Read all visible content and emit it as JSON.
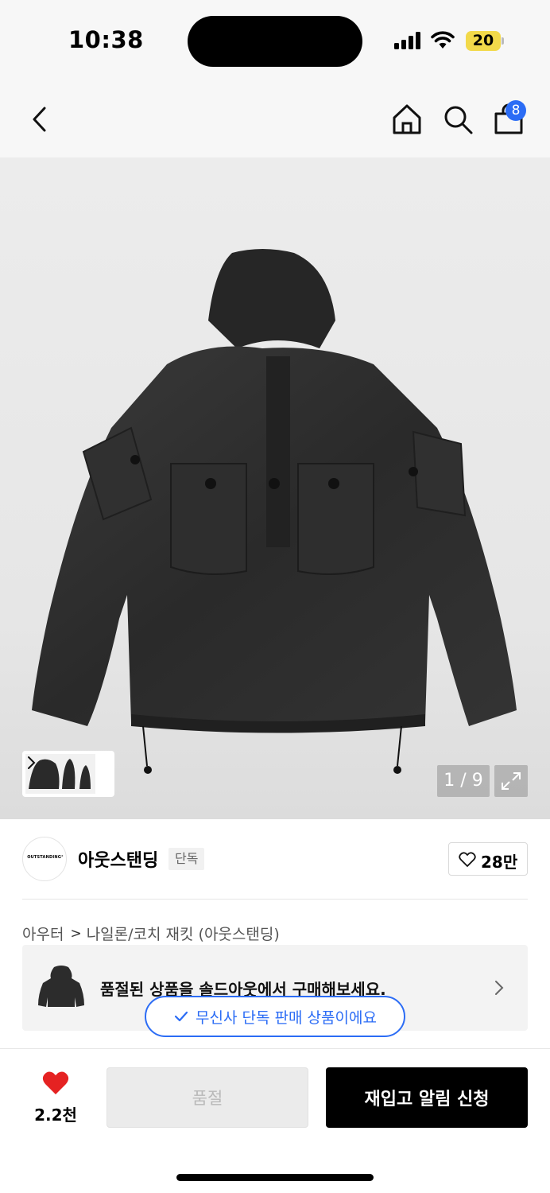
{
  "status_bar": {
    "time": "10:38",
    "battery": "20"
  },
  "nav": {
    "cart_count": "8"
  },
  "gallery": {
    "page_indicator": "1 / 9"
  },
  "brand": {
    "logo_text": "OUTSTANDING°",
    "name": "아웃스탠딩",
    "tag": "단독",
    "like_count": "28만"
  },
  "breadcrumb": {
    "category": "아우터",
    "separator": ">",
    "subcategory": "나일론/코치 재킷 (아웃스탠딩)"
  },
  "soldout_card": {
    "text": "품절된 상품을 솔드아웃에서 구매해보세요."
  },
  "exclusive_pill": {
    "text": "무신사 단독 판매 상품이에요"
  },
  "bottom_bar": {
    "like_count": "2.2천",
    "soldout_label": "품절",
    "restock_label": "재입고 알림 신청"
  },
  "colors": {
    "accent_blue": "#2b6cf5",
    "heart_red": "#e52222",
    "battery_yellow": "#f2d94a"
  }
}
